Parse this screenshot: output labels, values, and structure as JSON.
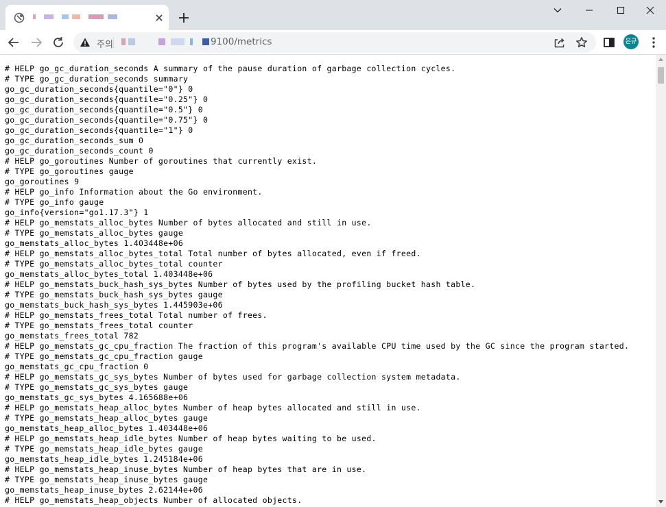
{
  "browser": {
    "tab": {
      "close_icon": "close-icon",
      "favicon_icon": "globe-icon"
    },
    "new_tab_icon": "plus-icon",
    "window_controls": [
      "chevron-down-icon",
      "minimize-icon",
      "maximize-icon",
      "close-icon"
    ],
    "toolbar": {
      "back_icon": "arrow-left-icon",
      "forward_icon": "arrow-right-icon",
      "reload_icon": "reload-icon",
      "security_warning_icon": "warning-icon",
      "security_label": "주의",
      "url_visible_path": "9100/metrics",
      "share_icon": "share-icon",
      "bookmark_icon": "star-icon",
      "sidepanel_icon": "sidepanel-icon",
      "profile_initials": "은규",
      "profile_color": "#0e8591",
      "menu_icon": "more-vert-icon"
    }
  },
  "metrics_lines": [
    "# HELP go_gc_duration_seconds A summary of the pause duration of garbage collection cycles.",
    "# TYPE go_gc_duration_seconds summary",
    "go_gc_duration_seconds{quantile=\"0\"} 0",
    "go_gc_duration_seconds{quantile=\"0.25\"} 0",
    "go_gc_duration_seconds{quantile=\"0.5\"} 0",
    "go_gc_duration_seconds{quantile=\"0.75\"} 0",
    "go_gc_duration_seconds{quantile=\"1\"} 0",
    "go_gc_duration_seconds_sum 0",
    "go_gc_duration_seconds_count 0",
    "# HELP go_goroutines Number of goroutines that currently exist.",
    "# TYPE go_goroutines gauge",
    "go_goroutines 9",
    "# HELP go_info Information about the Go environment.",
    "# TYPE go_info gauge",
    "go_info{version=\"go1.17.3\"} 1",
    "# HELP go_memstats_alloc_bytes Number of bytes allocated and still in use.",
    "# TYPE go_memstats_alloc_bytes gauge",
    "go_memstats_alloc_bytes 1.403448e+06",
    "# HELP go_memstats_alloc_bytes_total Total number of bytes allocated, even if freed.",
    "# TYPE go_memstats_alloc_bytes_total counter",
    "go_memstats_alloc_bytes_total 1.403448e+06",
    "# HELP go_memstats_buck_hash_sys_bytes Number of bytes used by the profiling bucket hash table.",
    "# TYPE go_memstats_buck_hash_sys_bytes gauge",
    "go_memstats_buck_hash_sys_bytes 1.445903e+06",
    "# HELP go_memstats_frees_total Total number of frees.",
    "# TYPE go_memstats_frees_total counter",
    "go_memstats_frees_total 782",
    "# HELP go_memstats_gc_cpu_fraction The fraction of this program's available CPU time used by the GC since the program started.",
    "# TYPE go_memstats_gc_cpu_fraction gauge",
    "go_memstats_gc_cpu_fraction 0",
    "# HELP go_memstats_gc_sys_bytes Number of bytes used for garbage collection system metadata.",
    "# TYPE go_memstats_gc_sys_bytes gauge",
    "go_memstats_gc_sys_bytes 4.165688e+06",
    "# HELP go_memstats_heap_alloc_bytes Number of heap bytes allocated and still in use.",
    "# TYPE go_memstats_heap_alloc_bytes gauge",
    "go_memstats_heap_alloc_bytes 1.403448e+06",
    "# HELP go_memstats_heap_idle_bytes Number of heap bytes waiting to be used.",
    "# TYPE go_memstats_heap_idle_bytes gauge",
    "go_memstats_heap_idle_bytes 1.245184e+06",
    "# HELP go_memstats_heap_inuse_bytes Number of heap bytes that are in use.",
    "# TYPE go_memstats_heap_inuse_bytes gauge",
    "go_memstats_heap_inuse_bytes 2.62144e+06",
    "# HELP go_memstats_heap_objects Number of allocated objects."
  ]
}
